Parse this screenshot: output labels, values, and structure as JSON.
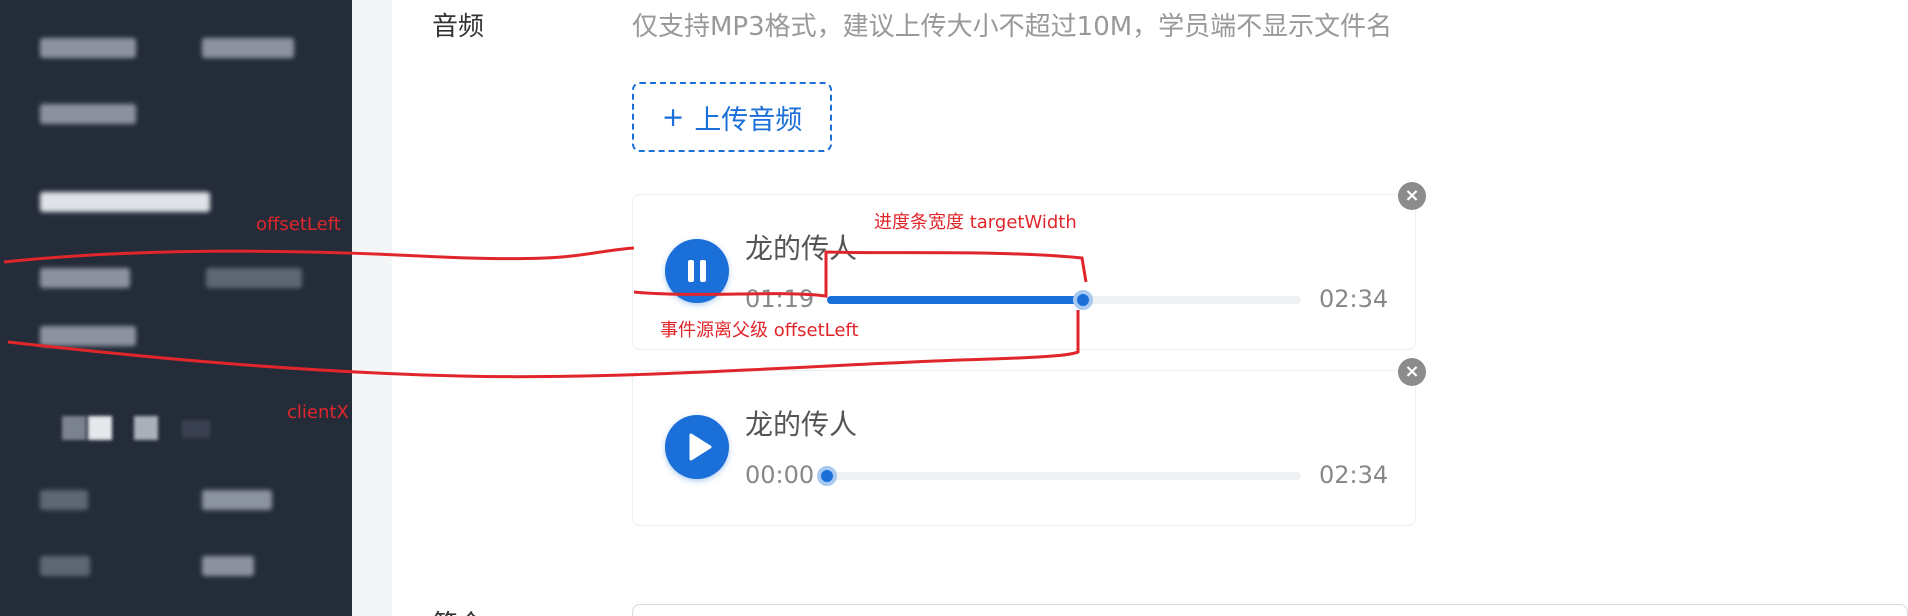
{
  "form": {
    "audio_label": "音频",
    "audio_hint": "仅支持MP3格式，建议上传大小不超过10M，学员端不显示文件名",
    "upload_button_label": "上传音频",
    "upload_button_plus": "+",
    "next_label": "简介"
  },
  "tracks": [
    {
      "title": "龙的传人",
      "current_time": "01:19",
      "duration": "02:34",
      "state": "playing",
      "progress": 0.54
    },
    {
      "title": "龙的传人",
      "current_time": "00:00",
      "duration": "02:34",
      "state": "paused",
      "progress": 0
    }
  ],
  "annotations": {
    "offset_left": "offsetLeft",
    "client_x": "clientX",
    "target_width": "进度条宽度 targetWidth",
    "parent_offset": "事件源离父级 offsetLeft"
  },
  "colors": {
    "sidebar_bg": "#242c3a",
    "accent": "#1a6fd8",
    "annotation": "#e0262b"
  },
  "icons": {
    "pause": "pause-icon",
    "play": "play-icon",
    "close": "close-icon"
  }
}
